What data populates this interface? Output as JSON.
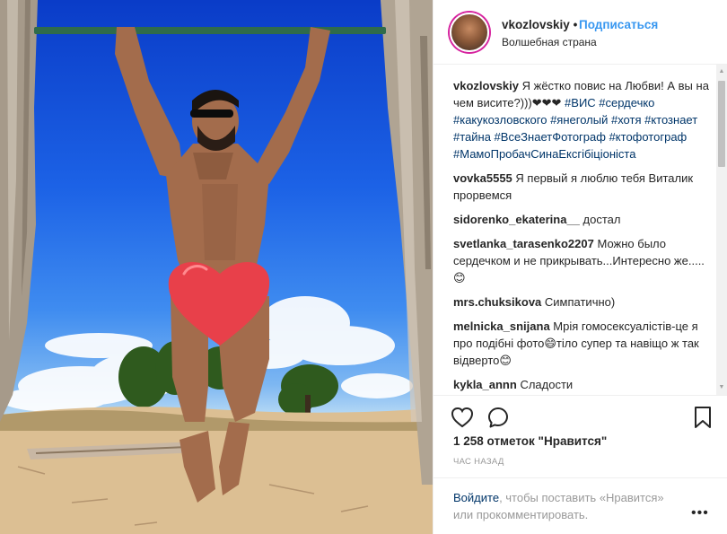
{
  "header": {
    "username": "vkozlovskiy",
    "dot": "•",
    "follow_label": "Подписаться",
    "location": "Волшебная страна"
  },
  "caption": {
    "username": "vkozlovskiy",
    "text": "Я жёстко повис на Любви! А вы на чем висите?)))❤❤❤",
    "hashtags": "#ВИС #сердечко #какукозловского #янеголый #хотя #ктознает #тайна #ВсеЗнаетФотограф #ктофотограф #МамоПробачСинаЕксгібіціоніста"
  },
  "comments": [
    {
      "user": "vovka5555",
      "text": "Я первый я люблю тебя Виталик прорвемся"
    },
    {
      "user": "sidorenko_ekaterina__",
      "text": "достал"
    },
    {
      "user": "svetlanka_tarasenko2207",
      "text": "Можно было сердечком и не прикрывать...Интересно же.....😊"
    },
    {
      "user": "mrs.chuksikova",
      "text": "Симпатично)"
    },
    {
      "user": "melnicka_snijana",
      "text": "Мрія гомосексуалістів-це я про подібні фото😄тіло супер та навіщо ж так відверто😊"
    },
    {
      "user": "kykla_annn",
      "text": "Сладости"
    }
  ],
  "likes_text": "1 258 отметок \"Нравится\"",
  "time_text": "ЧАС НАЗАД",
  "login": {
    "link": "Войдите",
    "text": ", чтобы поставить «Нравится» или прокомментировать."
  },
  "more_label": "•••",
  "colors": {
    "link_blue": "#3897f0",
    "hashtag_blue": "#003569",
    "muted": "#999999",
    "heart_red": "#e8404a"
  },
  "icons": {
    "like": "heart-outline-icon",
    "comment": "speech-bubble-icon",
    "save": "bookmark-icon",
    "more": "ellipsis-icon"
  }
}
